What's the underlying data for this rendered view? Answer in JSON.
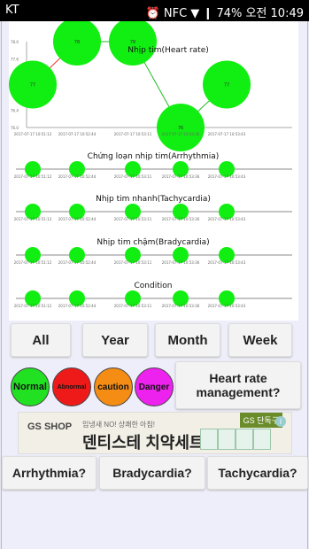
{
  "status_bar": {
    "carrier": "KT",
    "right": "⏰ NFC ▼ ❙ 74% 오전 10:49"
  },
  "chart_data": [
    {
      "type": "scatter",
      "title": "Nhịp tim(Heart rate)",
      "x": [
        "2017-07-17 10:51:12",
        "2017-07-17 10:52:44",
        "2017-07-17 10:53:11",
        "2017-07-17 10:53:36",
        "2017-07-17 10:53:43"
      ],
      "values": [
        77,
        78,
        78,
        76,
        77
      ],
      "ylim": [
        76.0,
        78.0
      ],
      "yticks": [
        "78.0",
        "77.6",
        "77.2",
        "76.8",
        "76.4",
        "76.0"
      ],
      "point_labels": [
        "77",
        "78",
        "78",
        "76",
        "77"
      ]
    },
    {
      "type": "scatter",
      "title": "Chứng loạn nhịp tim(Arrhythmia)",
      "x": [
        "2017-07-17 10:51:12",
        "2017-07-17 10:52:44",
        "2017-07-17 10:53:11",
        "2017-07-17 10:53:36",
        "2017-07-17 10:53:43"
      ],
      "values": [
        0,
        0,
        0,
        0,
        0
      ]
    },
    {
      "type": "scatter",
      "title": "Nhịp tim nhanh(Tachycardia)",
      "x": [
        "2017-07-17 10:51:12",
        "2017-07-17 10:52:44",
        "2017-07-17 10:53:11",
        "2017-07-17 10:53:36",
        "2017-07-17 10:53:43"
      ],
      "values": [
        0,
        0,
        0,
        0,
        0
      ]
    },
    {
      "type": "scatter",
      "title": "Nhịp tim chậm(Bradycardia)",
      "x": [
        "2017-07-17 10:51:12",
        "2017-07-17 10:52:44",
        "2017-07-17 10:53:11",
        "2017-07-17 10:53:36",
        "2017-07-17 10:53:43"
      ],
      "values": [
        0,
        0,
        0,
        0,
        0
      ]
    },
    {
      "type": "scatter",
      "title": "Condition",
      "x": [
        "2017-07-17 10:51:12",
        "2017-07-17 10:52:44",
        "2017-07-17 10:53:11",
        "2017-07-17 10:53:36",
        "2017-07-17 10:53:43"
      ],
      "values": [
        0,
        0,
        0,
        0,
        0
      ]
    }
  ],
  "range_buttons": [
    "All",
    "Year",
    "Month",
    "Week"
  ],
  "legend_circles": [
    {
      "label": "Normal",
      "color": "#22e022"
    },
    {
      "label": "Abnormal",
      "color": "#ee1a1a"
    },
    {
      "label": "caution",
      "color": "#f58c14"
    },
    {
      "label": "Danger",
      "color": "#ee22ee"
    }
  ],
  "management_button": "Heart rate management?",
  "ad": {
    "brand": "GS SHOP",
    "small": "임냉새 NO! 상쾌한 아침!",
    "main": "덴티스테 치약세트",
    "tag": "GS 단독구",
    "info": "i"
  },
  "bottom_buttons": [
    "Arrhythmia?",
    "Bradycardia?",
    "Tachycardia?"
  ]
}
